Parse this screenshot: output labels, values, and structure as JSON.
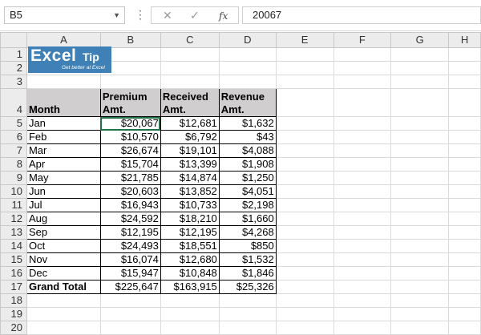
{
  "formula_bar": {
    "name_box": "B5",
    "formula_value": "20067",
    "fx_label": "fx"
  },
  "columns": [
    "A",
    "B",
    "C",
    "D",
    "E",
    "F",
    "G",
    "H"
  ],
  "rows": [
    "1",
    "2",
    "3",
    "4",
    "5",
    "6",
    "7",
    "8",
    "9",
    "10",
    "11",
    "12",
    "13",
    "14",
    "15",
    "16",
    "17",
    "18",
    "19",
    "20"
  ],
  "logo": {
    "word1": "Excel",
    "word2": "Tip",
    "tagline": "Get better at Excel"
  },
  "table": {
    "headers": {
      "month": "Month",
      "premium": [
        "Premium",
        "Amt."
      ],
      "received": [
        "Received",
        "Amt."
      ],
      "revenue": [
        "Revenue",
        "Amt."
      ]
    },
    "data": [
      [
        "Jan",
        "$20,067",
        "$12,681",
        "$1,632"
      ],
      [
        "Feb",
        "$10,570",
        "$6,792",
        "$43"
      ],
      [
        "Mar",
        "$26,674",
        "$19,101",
        "$4,088"
      ],
      [
        "Apr",
        "$15,704",
        "$13,399",
        "$1,908"
      ],
      [
        "May",
        "$21,785",
        "$14,874",
        "$1,250"
      ],
      [
        "Jun",
        "$20,603",
        "$13,852",
        "$4,051"
      ],
      [
        "Jul",
        "$16,943",
        "$10,733",
        "$2,198"
      ],
      [
        "Aug",
        "$24,592",
        "$18,210",
        "$1,660"
      ],
      [
        "Sep",
        "$12,195",
        "$12,195",
        "$4,268"
      ],
      [
        "Oct",
        "$24,493",
        "$18,551",
        "$850"
      ],
      [
        "Nov",
        "$16,074",
        "$12,680",
        "$1,532"
      ],
      [
        "Dec",
        "$15,947",
        "$10,848",
        "$1,846"
      ]
    ],
    "total": [
      "Grand Total",
      "$225,647",
      "$163,915",
      "$25,326"
    ]
  }
}
